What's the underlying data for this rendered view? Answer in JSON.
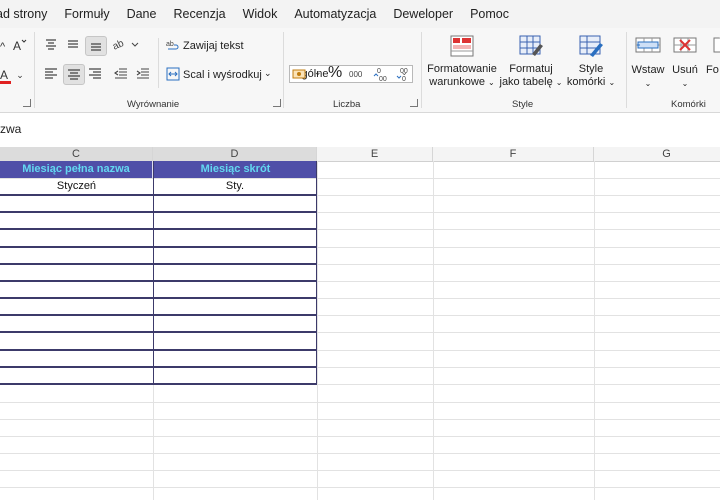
{
  "menu": [
    "ad strony",
    "Formuły",
    "Dane",
    "Recenzja",
    "Widok",
    "Automatyzacja",
    "Deweloper",
    "Pomoc"
  ],
  "ribbon": {
    "alignment": {
      "wrap_text": "Zawijaj tekst",
      "merge_center": "Scal i wyśrodkuj",
      "group_label": "Wyrównanie"
    },
    "number": {
      "format_value": "Ogólne",
      "percent": "%",
      "group_label": "Liczba"
    },
    "styles": {
      "conditional": "Formatowanie warunkowe",
      "format_table": "Formatuj jako tabelę",
      "cell_styles": "Style komórki",
      "group_label": "Style"
    },
    "cells": {
      "insert": "Wstaw",
      "delete": "Usuń",
      "format": "Fo",
      "group_label": "Komórki"
    }
  },
  "formula_bar": {
    "content": "zwa"
  },
  "columns": [
    "C",
    "D",
    "E",
    "F",
    "G"
  ],
  "table": {
    "headers": [
      "Miesiąc pełna nazwa",
      "Miesiąc skrót"
    ],
    "rows": [
      [
        "Styczeń",
        "Sty."
      ]
    ]
  },
  "colors": {
    "table_header_bg": "#4f4fa8",
    "table_header_text": "#63d7f0",
    "table_border": "#3c3a6a"
  }
}
